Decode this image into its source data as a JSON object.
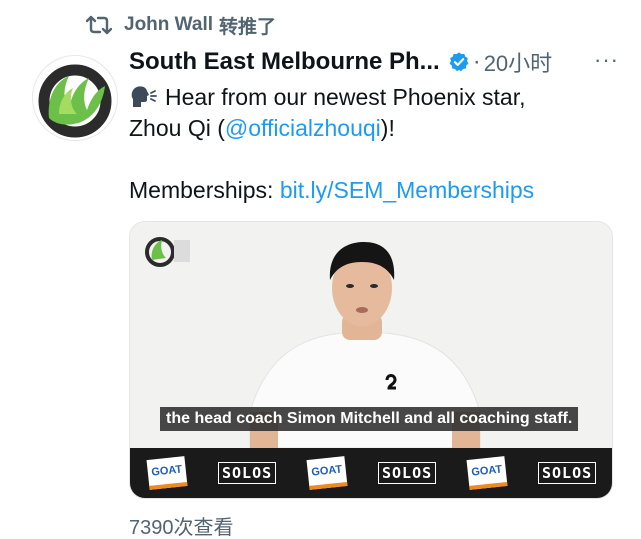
{
  "retweet": {
    "user": "John Wall",
    "label": "转推了"
  },
  "tweet": {
    "author_name": "South East Melbourne Ph...",
    "separator": "·",
    "time": "20小时",
    "more": "···",
    "text_line1": "Hear from our newest Phoenix star,",
    "text_line2_prefix": "Zhou Qi (",
    "mention": "@officialzhouqi",
    "text_line2_suffix": ")!",
    "memberships_label": "Memberships: ",
    "memberships_link": "bit.ly/SEM_Memberships",
    "icons": [
      "retweet-icon",
      "verified-badge-icon",
      "speaking-head-icon"
    ]
  },
  "media": {
    "caption": "the head coach Simon Mitchell and all coaching staff.",
    "sponsors": [
      "GOAT",
      "SOLOS",
      "GOAT",
      "SOLOS",
      "GOAT",
      "SOLOS"
    ]
  },
  "footer": {
    "views": "7390次查看"
  },
  "colors": {
    "link": "#1d9bf0",
    "secondary_text": "#536471",
    "brand_green": "#6cc04a"
  }
}
